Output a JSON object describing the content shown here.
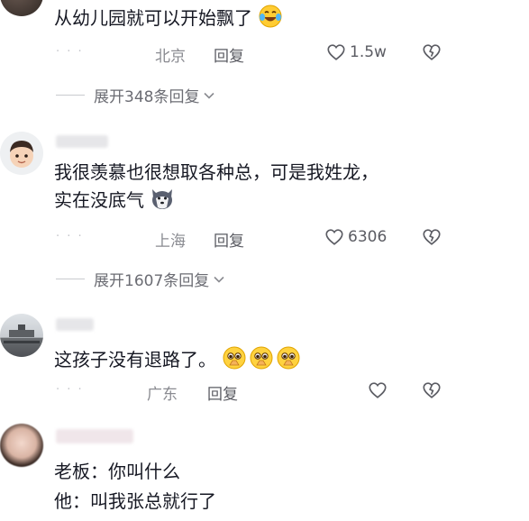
{
  "comments": [
    {
      "text": "从幼儿园就可以开始飘了",
      "location": "北京",
      "reply": "回复",
      "likes": "1.5w",
      "expand": "展开348条回复",
      "emoji": "laughing-tears-icon"
    },
    {
      "text_line1": "我很羡慕也很想取各种总，可是我姓龙，",
      "text_line2": "实在没底气",
      "location": "上海",
      "reply": "回复",
      "likes": "6306",
      "expand": "展开1607条回复",
      "emoji": "husky-dog-icon"
    },
    {
      "text": "这孩子没有退路了。",
      "location": "广东",
      "reply": "回复",
      "emoji": "pleading-face-icon"
    },
    {
      "text_line1": "老板：你叫什么",
      "text_line2": "他：叫我张总就行了"
    }
  ],
  "colors": {
    "text": "#161823",
    "meta": "#8a8b91",
    "icon": "#5b5c63"
  }
}
